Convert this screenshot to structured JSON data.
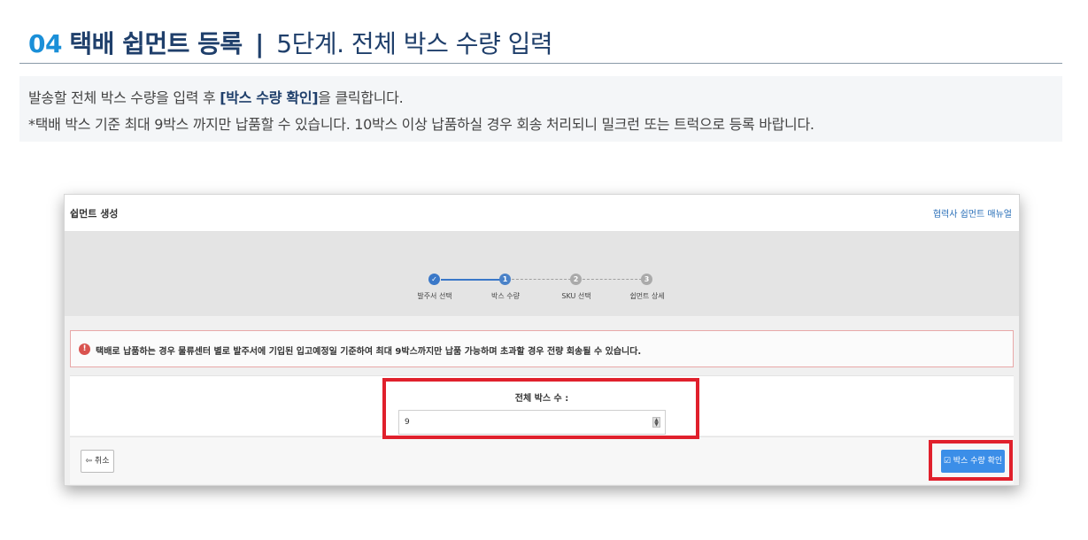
{
  "header": {
    "number": "04",
    "title": "택배 쉽먼트 등록",
    "separator": "|",
    "subtitle": "5단계. 전체 박스 수량 입력"
  },
  "description": {
    "line1_before": "발송할 전체 박스 수량을 입력 후 ",
    "line1_highlight": "[박스 수량 확인]",
    "line1_after": "을 클릭합니다.",
    "line2": "*택배 박스 기준 최대 9박스 까지만 납품할 수 있습니다. 10박스 이상 납품하실 경우 회송 처리되니 밀크런 또는 트럭으로 등록 바랍니다."
  },
  "screenshot": {
    "title": "쉽먼트 생성",
    "manual_link": "협력사 쉽먼트 매뉴얼",
    "steps": [
      {
        "label": "발주서 선택",
        "mark": "✓",
        "status": "done"
      },
      {
        "label": "박스 수량",
        "mark": "1",
        "status": "current"
      },
      {
        "label": "SKU 선택",
        "mark": "2",
        "status": "todo"
      },
      {
        "label": "쉽먼트 상세",
        "mark": "3",
        "status": "todo"
      }
    ],
    "alert_icon": "!",
    "alert_message": "택배로 납품하는 경우 물류센터 별로 발주서에 기입된 입고예정일 기준하여 최대 9박스까지만 납품 가능하며 초과할 경우 전량 회송될 수 있습니다.",
    "field_label": "전체 박스 수 :",
    "field_value": "9",
    "cancel_label": "취소",
    "cancel_icon": "⇦",
    "confirm_label": "박스 수량 확인",
    "confirm_icon": "☑"
  },
  "colors": {
    "accent": "#1a8fd8",
    "navy": "#1f3f6b",
    "highlight_box": "#e0202c",
    "confirm_button": "#3b8ee8"
  }
}
